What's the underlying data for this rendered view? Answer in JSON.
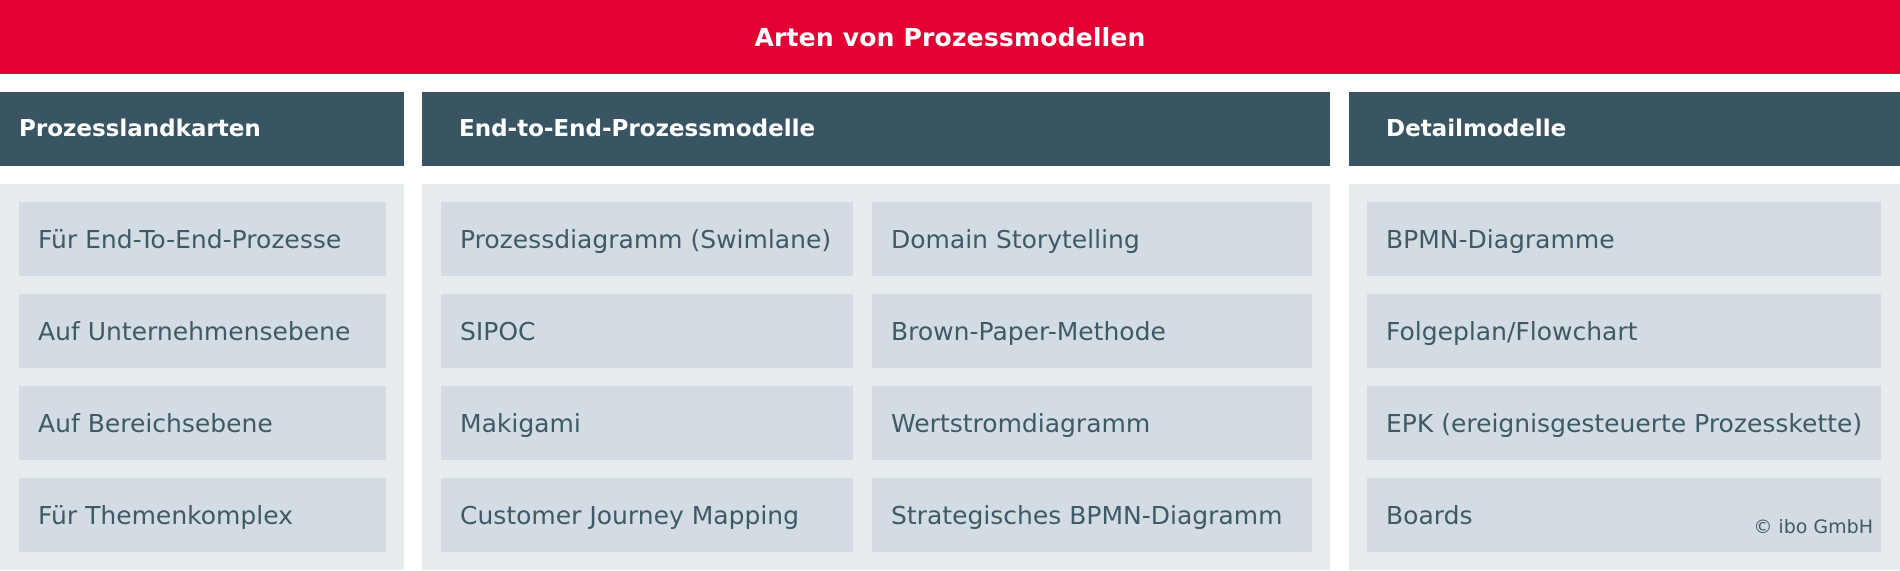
{
  "title": "Arten von Prozessmodellen",
  "columns": [
    {
      "header": "Prozesslandkarten",
      "items": [
        "Für End-To-End-Prozesse",
        "Auf Unternehmensebene",
        "Auf Bereichsebene",
        "Für Themenkomplex"
      ]
    },
    {
      "header": "End-to-End-Prozessmodelle",
      "items_left": [
        "Prozessdiagramm (Swimlane)",
        "SIPOC",
        "Makigami",
        "Customer Journey Mapping"
      ],
      "items_right": [
        "Domain Storytelling",
        "Brown-Paper-Methode",
        "Wertstromdiagramm",
        "Strategisches BPMN-Diagramm"
      ]
    },
    {
      "header": "Detailmodelle",
      "items": [
        "BPMN-Diagramme",
        "Folgeplan/Flowchart",
        "EPK (ereignisgesteuerte Prozesskette)",
        "Boards"
      ]
    }
  ],
  "copyright": "© ibo GmbH",
  "colors": {
    "banner": "#e30032",
    "header": "#395462",
    "panel": "#e7ecef",
    "box": "#d3dce3",
    "text": "#3f5a67"
  }
}
